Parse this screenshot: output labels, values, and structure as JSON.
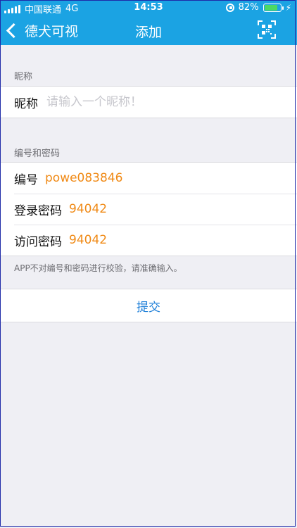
{
  "statusbar": {
    "carrier": "中国联通",
    "network": "4G",
    "time": "14:53",
    "battery_percent": "82%",
    "battery_level": 0.82
  },
  "navbar": {
    "back_label": "德犬可视",
    "title": "添加",
    "right_icon": "qr-scan-icon"
  },
  "nickname_section": {
    "header": "昵称",
    "field_label": "昵称",
    "placeholder": "请输入一个昵称！",
    "value": ""
  },
  "credentials_section": {
    "header": "编号和密码",
    "rows": [
      {
        "label": "编号",
        "value": "powe083846"
      },
      {
        "label": "登录密码",
        "value": "94042"
      },
      {
        "label": "访问密码",
        "value": "94042"
      }
    ],
    "note": "APP不对编号和密码进行校验，请准确输入。"
  },
  "submit_label": "提交",
  "colors": {
    "brand_blue": "#1BA3E3",
    "value_orange": "#F08A16",
    "link_blue": "#1E7FD8",
    "background": "#EFEFF4"
  }
}
